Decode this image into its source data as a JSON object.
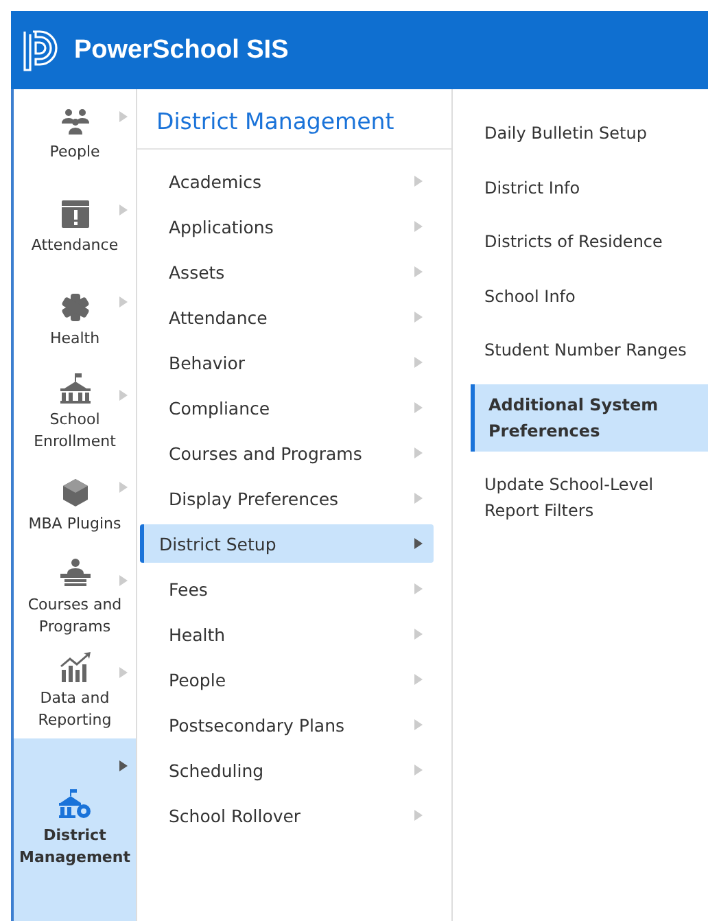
{
  "header": {
    "title": "PowerSchool SIS"
  },
  "sidebar": {
    "items": [
      {
        "kind": "people",
        "label": "People",
        "selected": false
      },
      {
        "kind": "attendance",
        "label": "Attendance",
        "selected": false
      },
      {
        "kind": "health",
        "label": "Health",
        "selected": false
      },
      {
        "kind": "school",
        "label": "School Enrollment",
        "selected": false
      },
      {
        "kind": "plugins",
        "label": "MBA Plugins",
        "selected": false
      },
      {
        "kind": "courses",
        "label": "Courses and Programs",
        "selected": false
      },
      {
        "kind": "data",
        "label": "Data and Reporting",
        "selected": false
      },
      {
        "kind": "district",
        "label": "District Management",
        "selected": true
      }
    ]
  },
  "menu": {
    "title": "District Management",
    "items": [
      {
        "label": "Academics",
        "selected": false
      },
      {
        "label": "Applications",
        "selected": false
      },
      {
        "label": "Assets",
        "selected": false
      },
      {
        "label": "Attendance",
        "selected": false
      },
      {
        "label": "Behavior",
        "selected": false
      },
      {
        "label": "Compliance",
        "selected": false
      },
      {
        "label": "Courses and Programs",
        "selected": false
      },
      {
        "label": "Display Preferences",
        "selected": false
      },
      {
        "label": "District Setup",
        "selected": true
      },
      {
        "label": "Fees",
        "selected": false
      },
      {
        "label": "Health",
        "selected": false
      },
      {
        "label": "People",
        "selected": false
      },
      {
        "label": "Postsecondary Plans",
        "selected": false
      },
      {
        "label": "Scheduling",
        "selected": false
      },
      {
        "label": "School Rollover",
        "selected": false
      }
    ]
  },
  "submenu": {
    "items": [
      {
        "label": "Daily Bulletin Setup",
        "selected": false
      },
      {
        "label": "District Info",
        "selected": false
      },
      {
        "label": "Districts of Residence",
        "selected": false
      },
      {
        "label": "School Info",
        "selected": false
      },
      {
        "label": "Student Number Ranges",
        "selected": false
      },
      {
        "label": "Additional System Preferences",
        "selected": true
      },
      {
        "label": "Update School-Level Report Filters",
        "selected": false
      }
    ]
  }
}
